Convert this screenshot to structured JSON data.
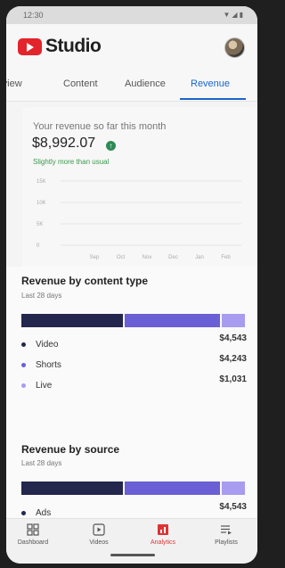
{
  "status_bar": {
    "time": "12:30",
    "icons": "▼◢▮"
  },
  "header": {
    "title": "Studio",
    "logo_icon": "youtube-play-icon",
    "avatar": "profile-avatar"
  },
  "tabs": [
    {
      "label": "rview"
    },
    {
      "label": "Content"
    },
    {
      "label": "Audience"
    },
    {
      "label": "Revenue",
      "active": true
    }
  ],
  "revenue_summary": {
    "label": "Your revenue so far this month",
    "amount": "$8,992.07",
    "trend_icon": "arrow-up-icon",
    "note": "Slightly more than usual"
  },
  "chart_data": {
    "type": "line",
    "categories": [
      "Sep",
      "Oct",
      "Nov",
      "Dec",
      "Jan",
      "Feb"
    ],
    "y_ticks": [
      "15K",
      "10K",
      "5K",
      "0"
    ],
    "ylim": [
      0,
      15000
    ],
    "grid": true
  },
  "content_type": {
    "title": "Revenue by content type",
    "subtitle": "Last 28 days",
    "items": [
      {
        "label": "Video",
        "value": "$4,543",
        "color": "#23264d"
      },
      {
        "label": "Shorts",
        "value": "$4,243",
        "color": "#6b5fd6"
      },
      {
        "label": "Live",
        "value": "$1,031",
        "color": "#a79cf0"
      }
    ]
  },
  "source": {
    "title": "Revenue by source",
    "subtitle": "Last 28 days",
    "items": [
      {
        "label": "Ads",
        "value": "$4,543",
        "color": "#23264d"
      }
    ]
  },
  "bottom_nav": [
    {
      "label": "Dashboard",
      "icon": "dashboard-icon"
    },
    {
      "label": "Videos",
      "icon": "video-icon"
    },
    {
      "label": "Analytics",
      "icon": "analytics-icon",
      "active": true
    },
    {
      "label": "Playlists",
      "icon": "playlist-icon"
    }
  ],
  "colors": {
    "accent": "#1a66cc",
    "brand": "#e3242b",
    "positive": "#3b9a4c",
    "nav_active": "#d33333"
  }
}
